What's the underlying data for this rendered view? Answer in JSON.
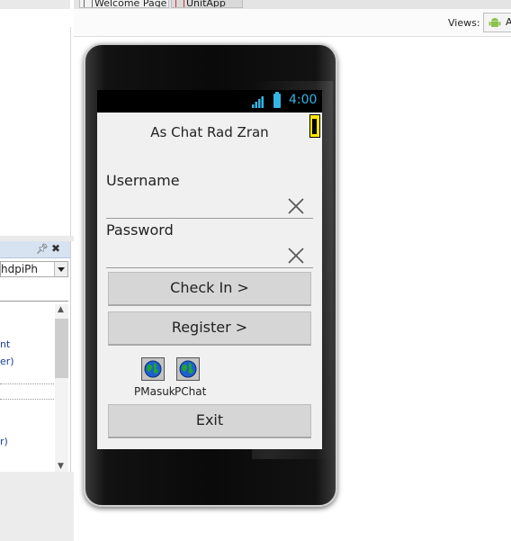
{
  "tabs": [
    {
      "label": "Welcome Page"
    },
    {
      "label": "UnitApp"
    }
  ],
  "toolbar": {
    "views_label": "Views:",
    "views_button_text": "A"
  },
  "side_panel": {
    "combo_value": "hdpiPh",
    "list": [
      "nt",
      "er)",
      "r)"
    ]
  },
  "device": {
    "clock": "4:00",
    "accent_color": "#33b5e5"
  },
  "app": {
    "title": "As Chat Rad Zran",
    "username_label": "Username",
    "username_value": "",
    "password_label": "Password",
    "password_value": "",
    "check_in_button": "Check In >",
    "register_button": "Register >",
    "icon_buttons": [
      {
        "label": "PMasuk",
        "icon": "globe-icon"
      },
      {
        "label": "PChat",
        "icon": "globe-icon"
      }
    ],
    "exit_button": "Exit"
  }
}
